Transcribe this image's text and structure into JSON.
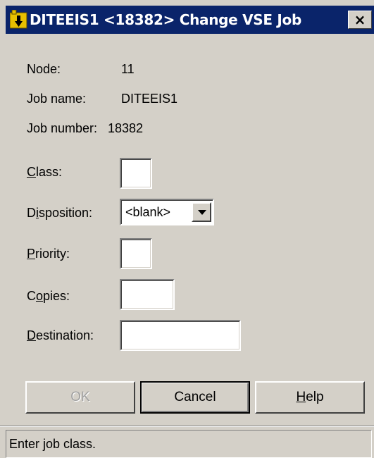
{
  "window": {
    "title": "DITEEIS1 <18382> Change VSE Job",
    "close_label": "×"
  },
  "info": {
    "node_label": "Node:",
    "node_value": "11",
    "jobname_label": "Job name:",
    "jobname_value": "DITEEIS1",
    "jobnumber_label": "Job number:",
    "jobnumber_value": "18382"
  },
  "form": {
    "class": {
      "label_mnemonic": "C",
      "label_rest": "lass:",
      "value": ""
    },
    "disposition": {
      "label_pre": "D",
      "label_mnemonic": "i",
      "label_rest": "sposition:",
      "value": "<blank>"
    },
    "priority": {
      "label_mnemonic": "P",
      "label_rest": "riority:",
      "value": ""
    },
    "copies": {
      "label_pre": "C",
      "label_mnemonic": "o",
      "label_rest": "pies:",
      "value": ""
    },
    "destination": {
      "label_mnemonic": "D",
      "label_rest": "estination:",
      "value": ""
    }
  },
  "buttons": {
    "ok": "OK",
    "cancel": "Cancel",
    "help_mnemonic": "H",
    "help_rest": "elp"
  },
  "status": {
    "text": "Enter job class."
  },
  "colors": {
    "titlebar": "#0a246a",
    "window_bg": "#d4d0c8",
    "disabled_text": "#a0a0a0"
  }
}
